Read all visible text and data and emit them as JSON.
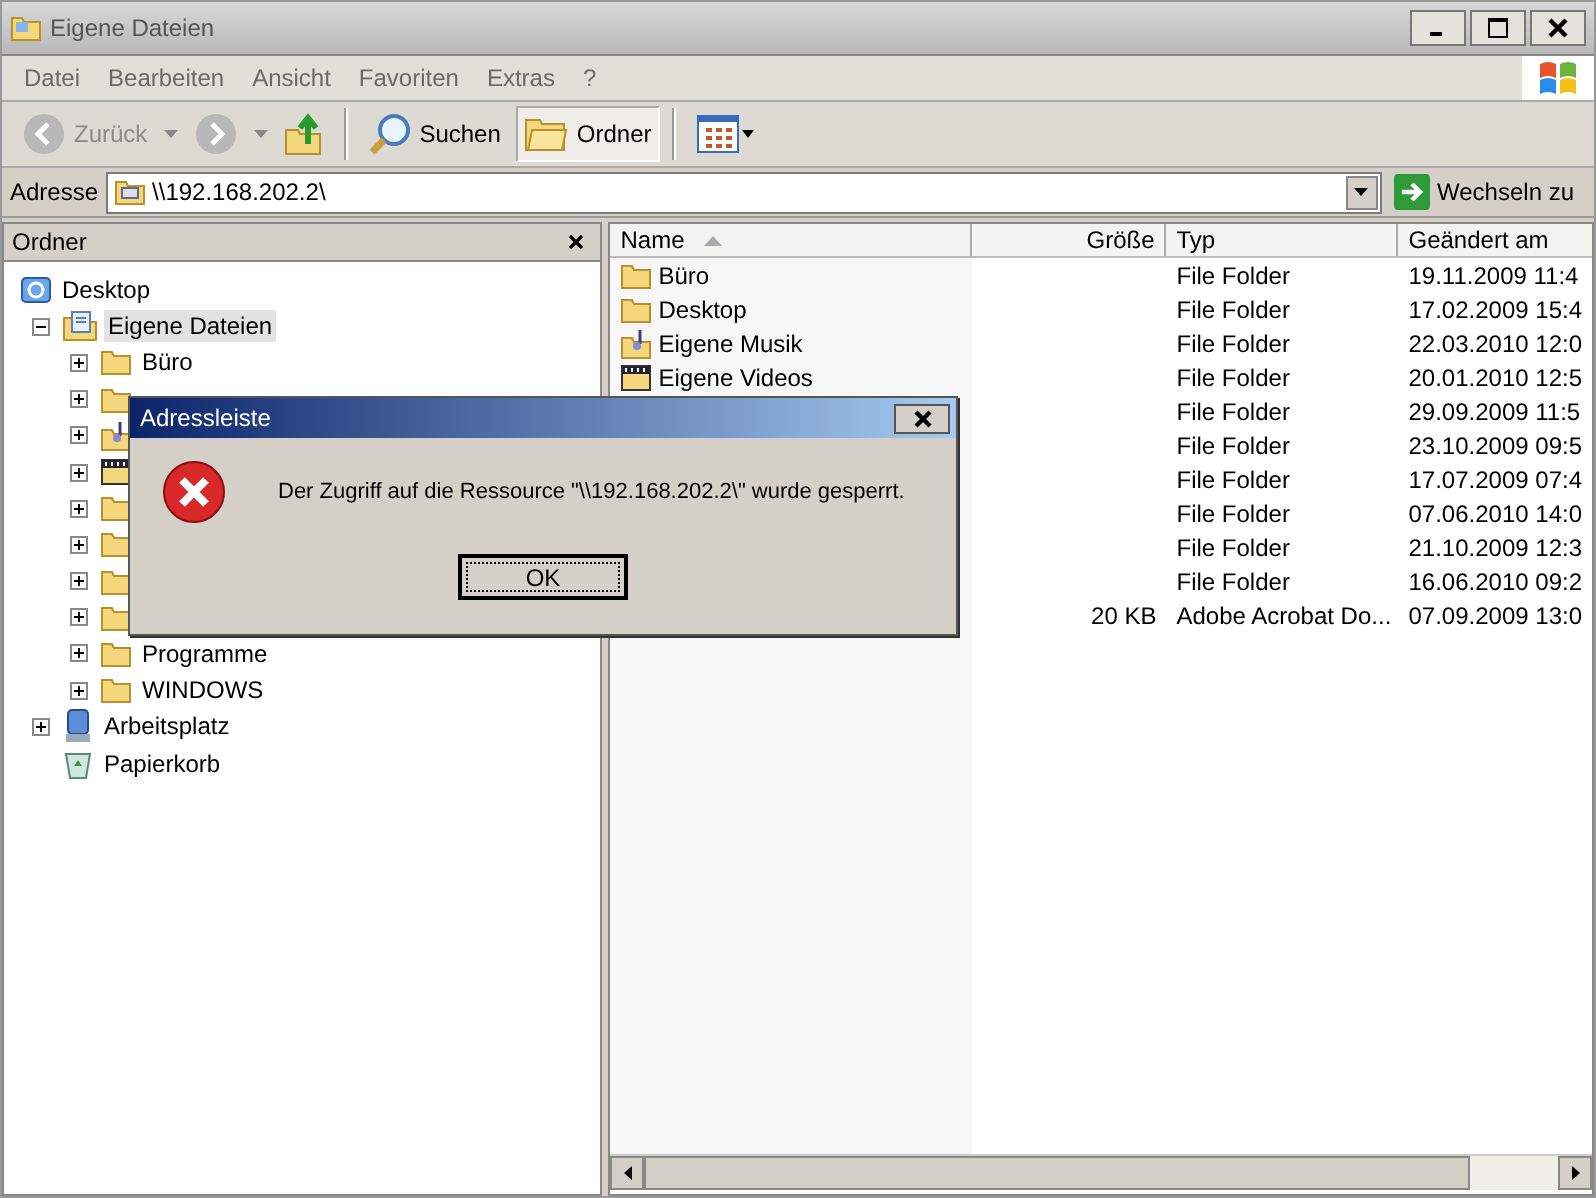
{
  "window": {
    "title": "Eigene Dateien"
  },
  "menu": [
    "Datei",
    "Bearbeiten",
    "Ansicht",
    "Favoriten",
    "Extras",
    "?"
  ],
  "toolbar": {
    "back": {
      "label": "Zurück",
      "disabled": true
    },
    "forward": {
      "disabled": true
    },
    "search": {
      "label": "Suchen"
    },
    "folders": {
      "label": "Ordner",
      "selected": true
    }
  },
  "address": {
    "label": "Adresse",
    "value": "\\\\192.168.202.2\\",
    "go": "Wechseln zu"
  },
  "folder_pane": {
    "title": "Ordner",
    "tree": [
      {
        "label": "Desktop",
        "kind": "desktop",
        "selected": false,
        "children": [
          {
            "label": "Eigene Dateien",
            "kind": "documents",
            "expanded": true,
            "selected": true,
            "children": [
              {
                "label": "Büro",
                "kind": "folder",
                "expanded": false,
                "selected": false
              },
              {
                "kind": "folder",
                "expanded": false
              },
              {
                "kind": "music",
                "expanded": false
              },
              {
                "kind": "video",
                "expanded": false
              },
              {
                "kind": "folder",
                "expanded": false
              },
              {
                "kind": "folder",
                "expanded": false
              },
              {
                "kind": "folder",
                "expanded": false
              },
              {
                "kind": "folder",
                "expanded": false
              },
              {
                "label": "Programme",
                "kind": "folder",
                "expanded": false,
                "selected": false
              },
              {
                "label": "WINDOWS",
                "kind": "folder",
                "expanded": false,
                "selected": false
              }
            ]
          },
          {
            "label": "Arbeitsplatz",
            "kind": "computer",
            "expanded": false,
            "selected": false
          },
          {
            "label": "Papierkorb",
            "kind": "recycle",
            "selected": false
          }
        ]
      }
    ]
  },
  "file_list": {
    "columns": [
      "Name",
      "Größe",
      "Typ",
      "Geändert am"
    ],
    "rows": [
      {
        "name": "Büro",
        "kind": "folder",
        "size": "",
        "type": "File Folder",
        "modified": "19.11.2009 11:4"
      },
      {
        "name": "Desktop",
        "kind": "folder",
        "size": "",
        "type": "File Folder",
        "modified": "17.02.2009 15:4"
      },
      {
        "name": "Eigene Musik",
        "kind": "music",
        "size": "",
        "type": "File Folder",
        "modified": "22.03.2010 12:0"
      },
      {
        "name": "Eigene Videos",
        "kind": "video",
        "size": "",
        "type": "File Folder",
        "modified": "20.01.2010 12:5"
      },
      {
        "size": "",
        "type": "File Folder",
        "modified": "29.09.2009 11:5"
      },
      {
        "size": "",
        "type": "File Folder",
        "modified": "23.10.2009 09:5"
      },
      {
        "size": "",
        "type": "File Folder",
        "modified": "17.07.2009 07:4"
      },
      {
        "size": "",
        "type": "File Folder",
        "modified": "07.06.2010 14:0"
      },
      {
        "size": "",
        "type": "File Folder",
        "modified": "21.10.2009 12:3"
      },
      {
        "size": "",
        "type": "File Folder",
        "modified": "16.06.2010 09:2"
      },
      {
        "size": "20 KB",
        "type": "Adobe Acrobat Do...",
        "modified": "07.09.2009 13:0"
      }
    ]
  },
  "dialog": {
    "title": "Adressleiste",
    "message": "Der Zugriff auf die Ressource \"\\\\192.168.202.2\\\" wurde gesperrt.",
    "button": "OK"
  }
}
